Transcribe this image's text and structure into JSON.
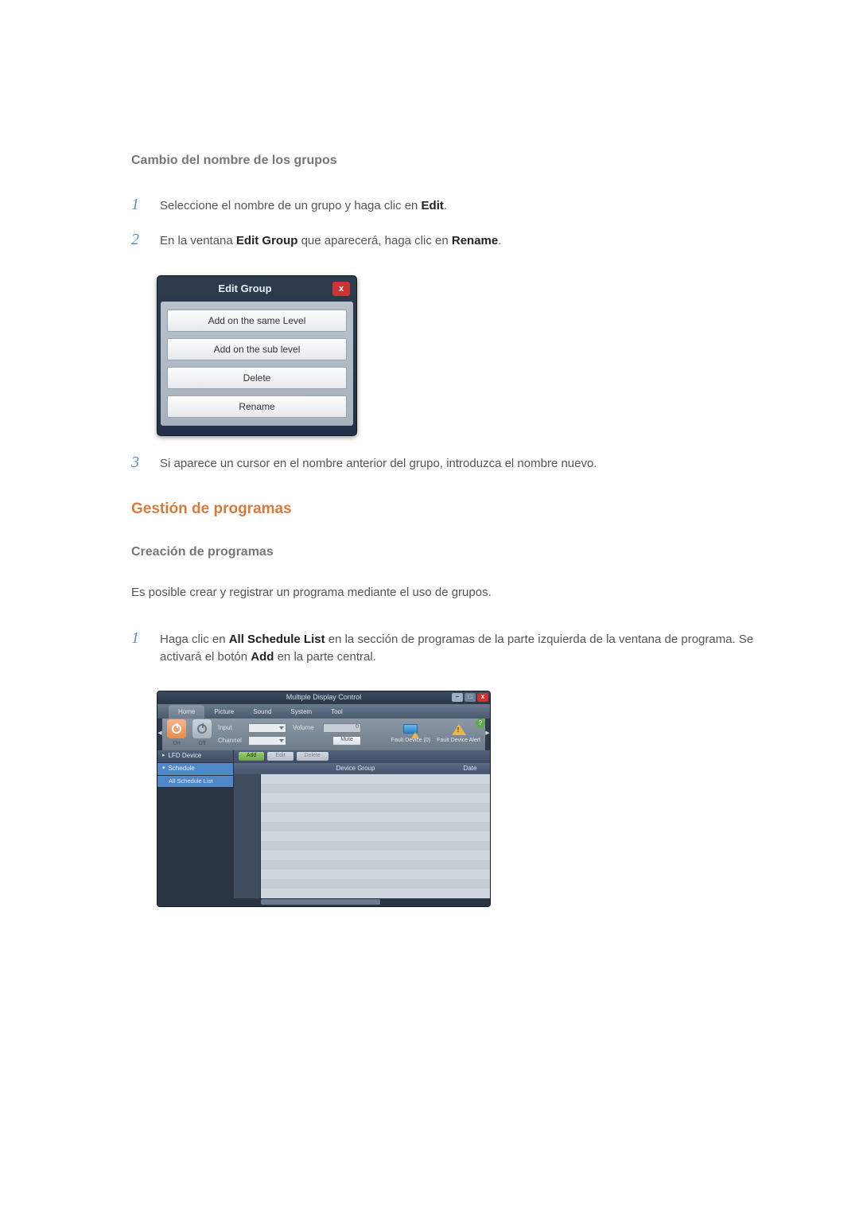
{
  "section1": {
    "heading": "Cambio del nombre de los grupos"
  },
  "steps1": {
    "s1_pre": "Seleccione el nombre de un grupo y haga clic en ",
    "s1_bold": "Edit",
    "s1_post": ".",
    "s2_pre": "En la ventana ",
    "s2_b1": "Edit Group",
    "s2_mid": " que aparecerá, haga clic en ",
    "s2_b2": "Rename",
    "s2_post": ".",
    "s3": "Si aparece un cursor en el nombre anterior del grupo, introduzca el nombre nuevo."
  },
  "nums": {
    "one": "1",
    "two": "2",
    "three": "3"
  },
  "edit_group": {
    "title": "Edit Group",
    "close": "x",
    "items": {
      "same": "Add on the same Level",
      "sub": "Add on the sub level",
      "del": "Delete",
      "ren": "Rename"
    }
  },
  "section2": {
    "heading": "Gestión de programas",
    "subhead": "Creación de programas",
    "intro": "Es posible crear y registrar un programa mediante el uso de grupos."
  },
  "steps2": {
    "s1_pre": "Haga clic en ",
    "s1_b1": "All Schedule List",
    "s1_mid": " en la sección de programas de la parte izquierda de la ventana de programa. Se activará el botón ",
    "s1_b2": "Add",
    "s1_post": " en la parte central."
  },
  "mdc": {
    "title": "Multiple Display Control",
    "win": {
      "min": "–",
      "max": "□",
      "close": "x",
      "help": "?"
    },
    "tabs": {
      "home": "Home",
      "picture": "Picture",
      "sound": "Sound",
      "system": "System",
      "tool": "Tool"
    },
    "ribbon": {
      "on": "On",
      "off": "Off",
      "input": "Input",
      "channel": "Channel",
      "volume": "Volume",
      "mute": "Mute",
      "slider_val": "0",
      "fault0": "Fault Device\n(0)",
      "fault_alert": "Fault Device\nAlert"
    },
    "side": {
      "lfd": "LFD Device",
      "schedule": "Schedule",
      "all": "All Schedule List"
    },
    "actions": {
      "add": "Add",
      "edit": "Edit",
      "delete": "Delete"
    },
    "grid": {
      "device_group": "Device Group",
      "date": "Date"
    }
  }
}
